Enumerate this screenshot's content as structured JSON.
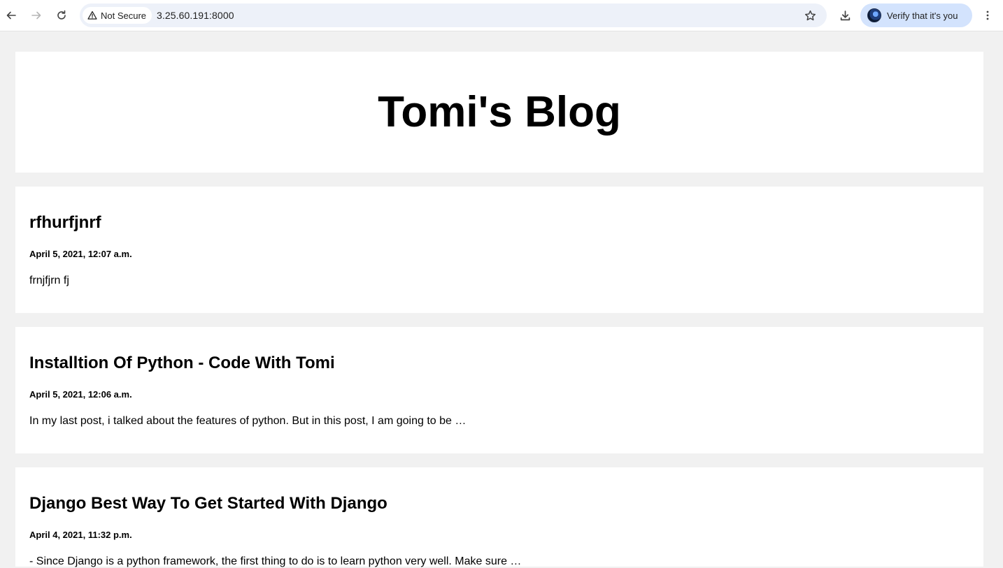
{
  "browser": {
    "security_label": "Not Secure",
    "url": "3.25.60.191:8000",
    "verify_label": "Verify that it's you"
  },
  "blog": {
    "title": "Tomi's Blog"
  },
  "posts": [
    {
      "title": "rfhurfjnrf",
      "date": "April 5, 2021, 12:07 a.m.",
      "excerpt": "frnjfjrn fj"
    },
    {
      "title": "Installtion Of Python - Code With Tomi",
      "date": "April 5, 2021, 12:06 a.m.",
      "excerpt": "In my last post, i talked about the features of python. But in this post, I am going to be …"
    },
    {
      "title": "Django Best Way To Get Started With Django",
      "date": "April 4, 2021, 11:32 p.m.",
      "excerpt": "- Since Django is a python framework, the first thing to do is to learn python very well. Make sure …"
    }
  ]
}
